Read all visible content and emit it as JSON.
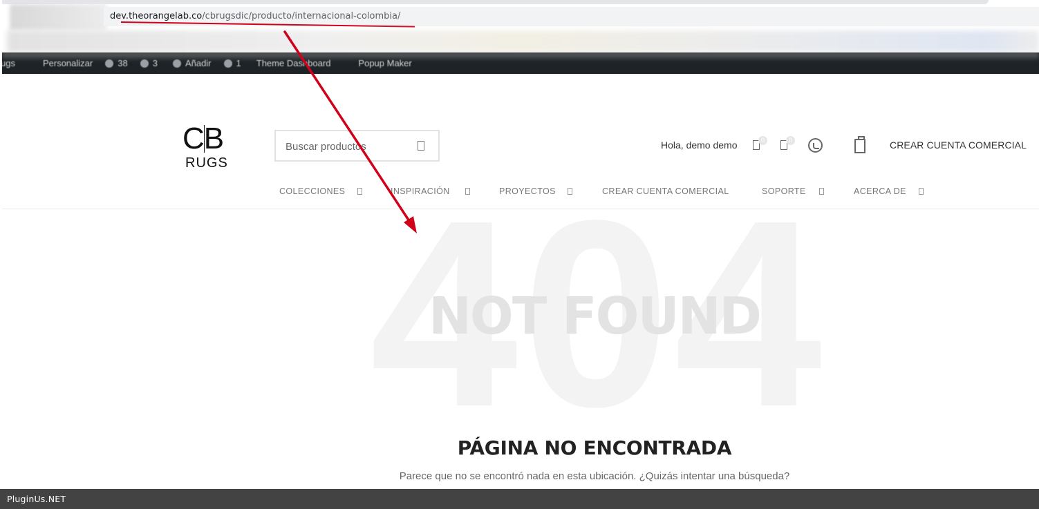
{
  "browser": {
    "url_domain": "dev.theorangelab.co",
    "url_path": "/cbrugsdic/producto/internacional-colombia/"
  },
  "admin_bar": {
    "items": [
      "ugs",
      "Personalizar",
      "38",
      "3",
      "Añadir",
      "1",
      "Theme Dashboard",
      "Popup Maker"
    ]
  },
  "header": {
    "logo_top": "CB",
    "logo_bottom": "RUGS",
    "search_placeholder": "Buscar productos",
    "greeting": "Hola, demo demo",
    "compare_count": "0",
    "wishlist_count": "0",
    "cta": "CREAR CUENTA COMERCIAL"
  },
  "nav": {
    "items": [
      "COLECCIONES",
      "INSPIRACIÓN",
      "PROYECTOS",
      "CREAR CUENTA COMERCIAL",
      "SOPORTE",
      "ACERCA DE"
    ]
  },
  "error": {
    "code": "404",
    "big_text": "NOT FOUND",
    "title": "PÁGINA NO ENCONTRADA",
    "message": "Parece que no se encontró nada en esta ubicación. ¿Quizás intentar una búsqueda?"
  },
  "footer_bar": {
    "text": "PluginUs.NET"
  },
  "colors": {
    "annotation_red": "#d0021b",
    "admin_bar": "#1d2327",
    "bottom_bar": "#434343"
  }
}
